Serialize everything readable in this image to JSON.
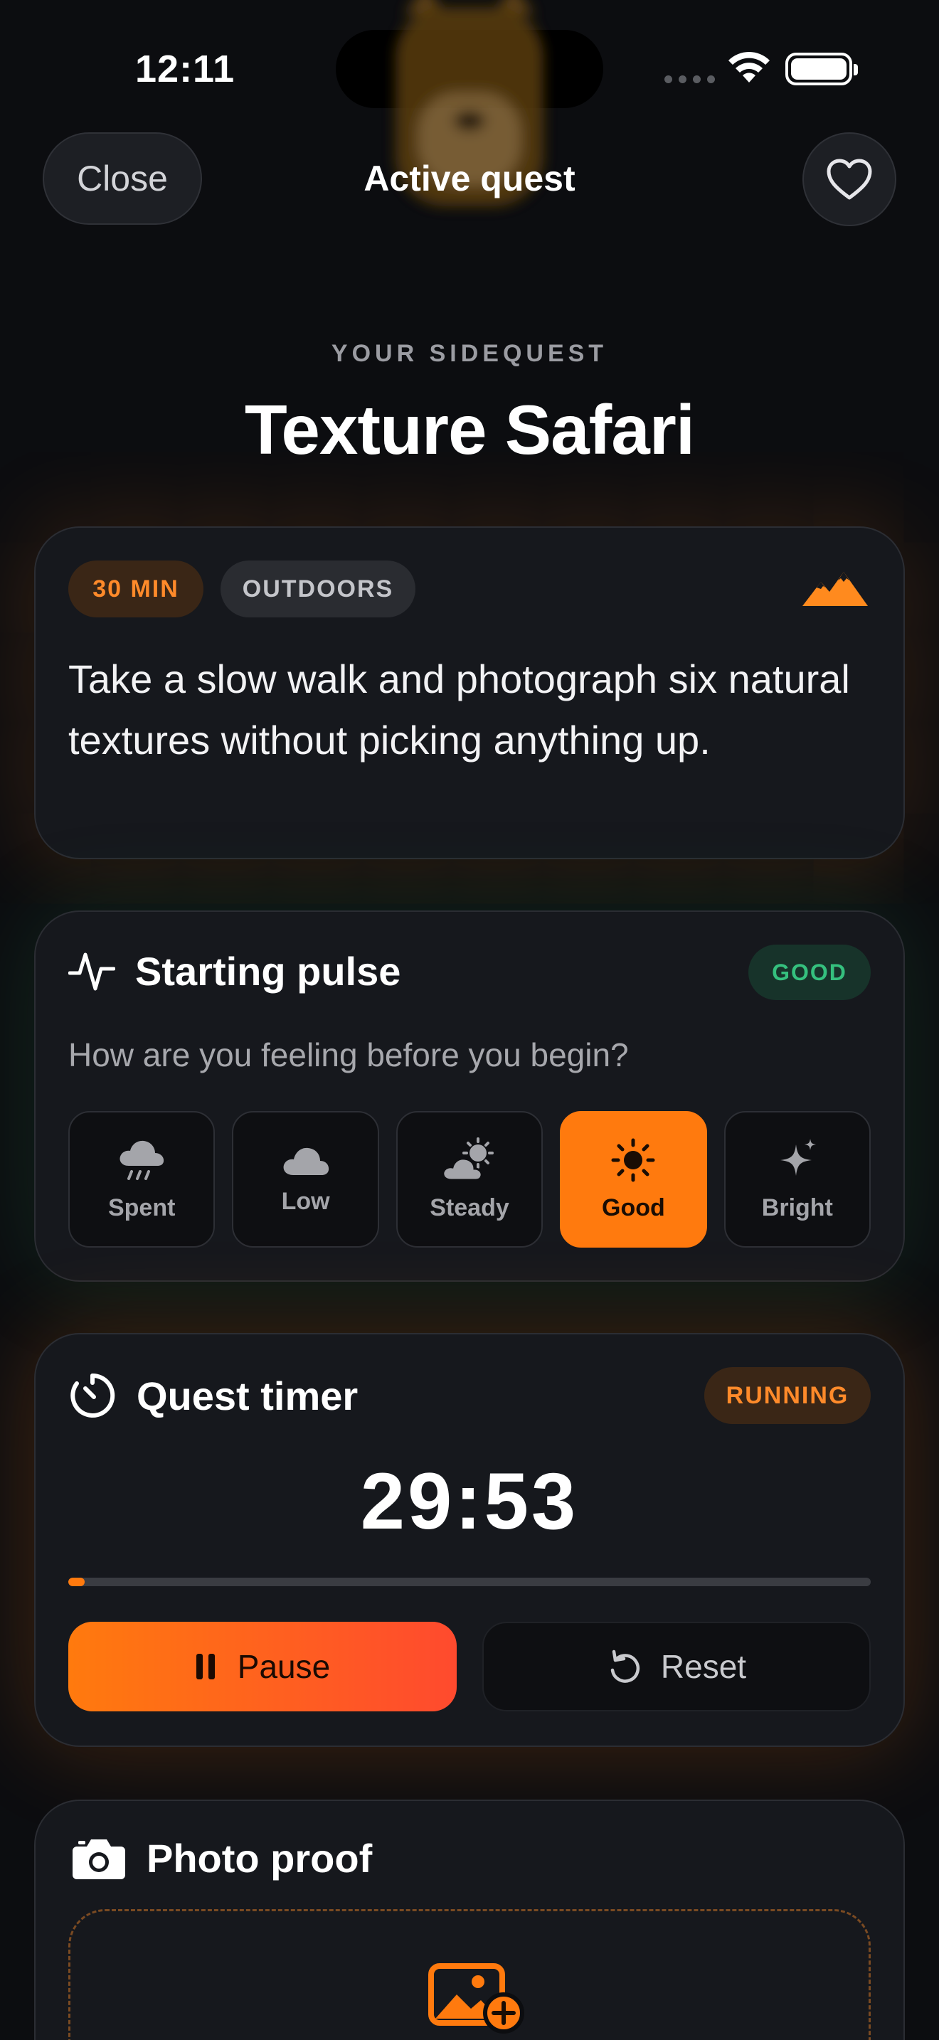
{
  "status_bar": {
    "time": "12:11"
  },
  "header": {
    "close_label": "Close",
    "title": "Active quest",
    "favorite_icon": "heart-icon"
  },
  "quest": {
    "eyebrow": "YOUR SIDEQUEST",
    "title": "Texture Safari",
    "duration": "30 MIN",
    "setting": "OUTDOORS",
    "description": "Take a slow walk and photograph six natural textures without picking anything up."
  },
  "pulse": {
    "title": "Starting pulse",
    "status": "GOOD",
    "question": "How are you feeling before you begin?",
    "options": [
      {
        "label": "Spent",
        "icon": "rain-cloud-icon"
      },
      {
        "label": "Low",
        "icon": "cloud-icon"
      },
      {
        "label": "Steady",
        "icon": "partly-sunny-icon"
      },
      {
        "label": "Good",
        "icon": "sun-icon"
      },
      {
        "label": "Bright",
        "icon": "sparkles-icon"
      }
    ],
    "selected": "Good"
  },
  "timer": {
    "title": "Quest timer",
    "status": "RUNNING",
    "remaining": "29:53",
    "progress": 0.02,
    "pause_label": "Pause",
    "reset_label": "Reset"
  },
  "photo": {
    "title": "Photo proof"
  },
  "colors": {
    "accent": "#ff7a0e",
    "accent_gradient_end": "#ff4a2e",
    "good": "#35c07e",
    "card": "#16181d",
    "background": "#0c0d10"
  }
}
